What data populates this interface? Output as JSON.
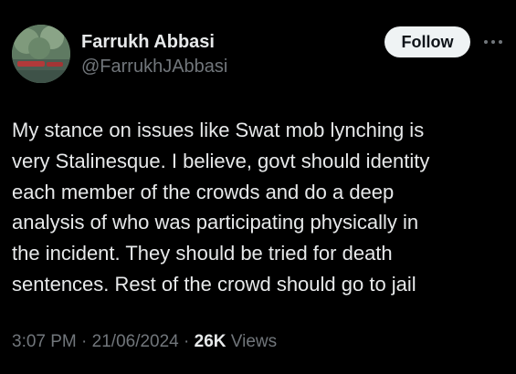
{
  "author": {
    "name": "Farrukh Abbasi",
    "handle": "@FarrukhJAbbasi",
    "avatar_icon": "profile-photo"
  },
  "actions": {
    "follow_label": "Follow",
    "more_icon": "more-horizontal-icon"
  },
  "tweet": {
    "text": "My stance on issues like Swat mob lynching is\nvery Stalinesque. I believe, govt should identity\neach member of the crowds and do a deep\nanalysis of who was participating physically in\nthe incident. They should be tried for death\nsentences. Rest of the crowd should go to jail"
  },
  "meta": {
    "time": "3:07 PM",
    "separator": " · ",
    "date": "21/06/2024",
    "views_count": "26K",
    "views_label": " Views"
  },
  "colors": {
    "background": "#000000",
    "primary_text": "#e7e9ea",
    "secondary_text": "#71767b",
    "follow_bg": "#eff3f4",
    "follow_text": "#0f1419"
  }
}
